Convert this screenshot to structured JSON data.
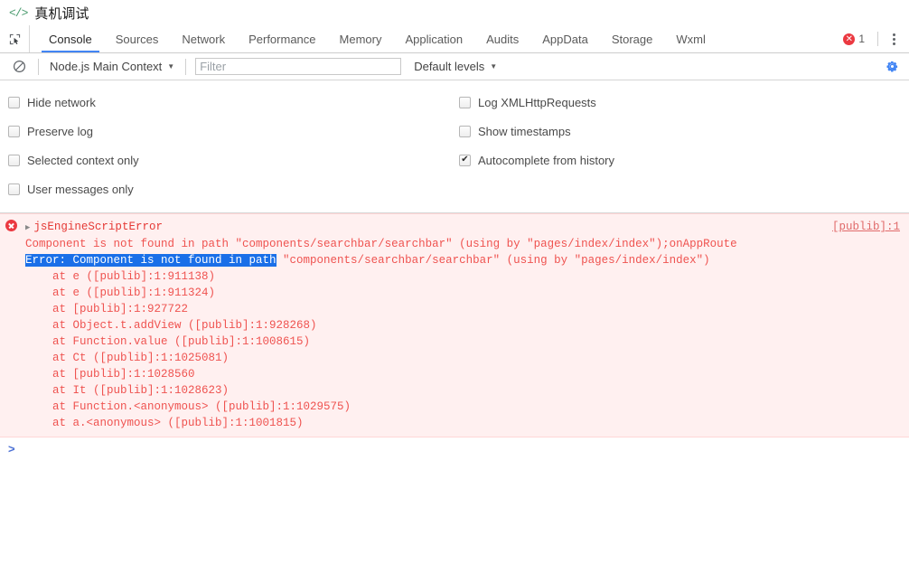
{
  "window": {
    "icon": "code-brackets-icon",
    "title": "真机调试"
  },
  "tabbar": {
    "inspect_icon": "inspect-element-icon",
    "tabs": [
      {
        "label": "Console",
        "active": true
      },
      {
        "label": "Sources",
        "active": false
      },
      {
        "label": "Network",
        "active": false
      },
      {
        "label": "Performance",
        "active": false
      },
      {
        "label": "Memory",
        "active": false
      },
      {
        "label": "Application",
        "active": false
      },
      {
        "label": "Audits",
        "active": false
      },
      {
        "label": "AppData",
        "active": false
      },
      {
        "label": "Storage",
        "active": false
      },
      {
        "label": "Wxml",
        "active": false
      }
    ],
    "error_badge": {
      "icon": "error-circle-icon",
      "count": "1"
    },
    "more_icon": "kebab-menu-icon",
    "active_tab_color": "#4285f4"
  },
  "toolbar": {
    "clear_icon": "clear-console-icon",
    "context": "Node.js Main Context",
    "context_caret": "▼",
    "filter_placeholder": "Filter",
    "filter_value": "",
    "levels": "Default levels",
    "levels_caret": "▼",
    "settings_icon": "gear-icon",
    "settings_icon_color": "#4285f4"
  },
  "settings": {
    "left": [
      {
        "label": "Hide network",
        "checked": false
      },
      {
        "label": "Preserve log",
        "checked": false
      },
      {
        "label": "Selected context only",
        "checked": false
      },
      {
        "label": "User messages only",
        "checked": false
      }
    ],
    "right": [
      {
        "label": "Log XMLHttpRequests",
        "checked": false
      },
      {
        "label": "Show timestamps",
        "checked": false
      },
      {
        "label": "Autocomplete from history",
        "checked": true
      }
    ]
  },
  "console": {
    "error": {
      "icon": "error-circle-icon",
      "disclosure": "▶",
      "title": "jsEngineScriptError",
      "source_link": "[publib]:1",
      "message_line": "Component is not found in path \"components/searchbar/searchbar\" (using by \"pages/index/index\");onAppRoute",
      "selected_text": "Error: Component is not found in path",
      "detail_tail": " \"components/searchbar/searchbar\" (using by \"pages/index/index\")",
      "selection_color": "#1a6fe8",
      "background": "#fff0f0",
      "text_color": "#ef5350",
      "stack": [
        "    at e ([publib]:1:911138)",
        "    at e ([publib]:1:911324)",
        "    at [publib]:1:927722",
        "    at Object.t.addView ([publib]:1:928268)",
        "    at Function.value ([publib]:1:1008615)",
        "    at Ct ([publib]:1:1025081)",
        "    at [publib]:1:1028560",
        "    at It ([publib]:1:1028623)",
        "    at Function.<anonymous> ([publib]:1:1029575)",
        "    at a.<anonymous> ([publib]:1:1001815)"
      ]
    },
    "prompt": ">"
  }
}
